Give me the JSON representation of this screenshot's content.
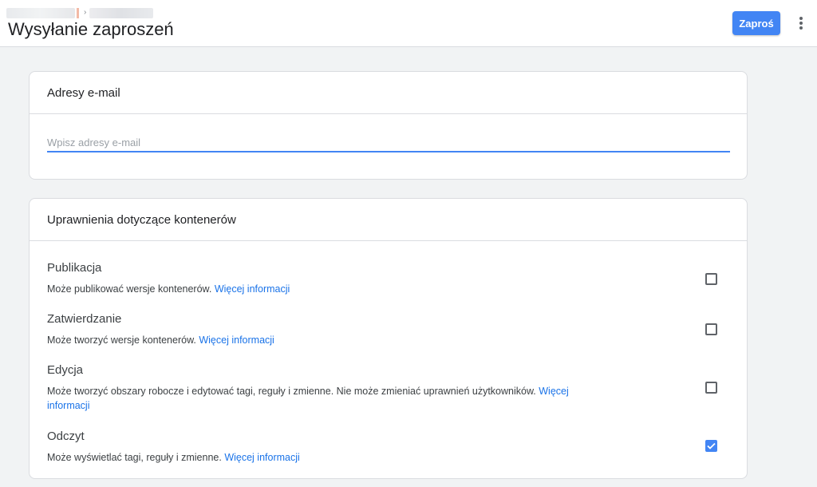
{
  "header": {
    "breadcrumb_separator": "›",
    "title": "Wysyłanie zaproszeń",
    "invite_label": "Zaproś"
  },
  "email_section": {
    "title": "Adresy e-mail",
    "placeholder": "Wpisz adresy e-mail",
    "value": ""
  },
  "permissions_section": {
    "title": "Uprawnienia dotyczące kontenerów",
    "items": [
      {
        "title": "Publikacja",
        "description": "Może publikować wersje kontenerów.",
        "link": "Więcej informacji",
        "checked": false
      },
      {
        "title": "Zatwierdzanie",
        "description": "Może tworzyć wersje kontenerów.",
        "link": "Więcej informacji",
        "checked": false
      },
      {
        "title": "Edycja",
        "description": "Może tworzyć obszary robocze i edytować tagi, reguły i zmienne. Nie może zmieniać uprawnień użytkowników.",
        "link": "Więcej informacji",
        "checked": false
      },
      {
        "title": "Odczyt",
        "description": "Może wyświetlać tagi, reguły i zmienne.",
        "link": "Więcej informacji",
        "checked": true
      }
    ]
  },
  "colors": {
    "accent": "#4285f4",
    "link": "#1a73e8",
    "background": "#f1f3f4"
  },
  "icons": {
    "more": "more-vert-icon",
    "check": "check-icon"
  }
}
